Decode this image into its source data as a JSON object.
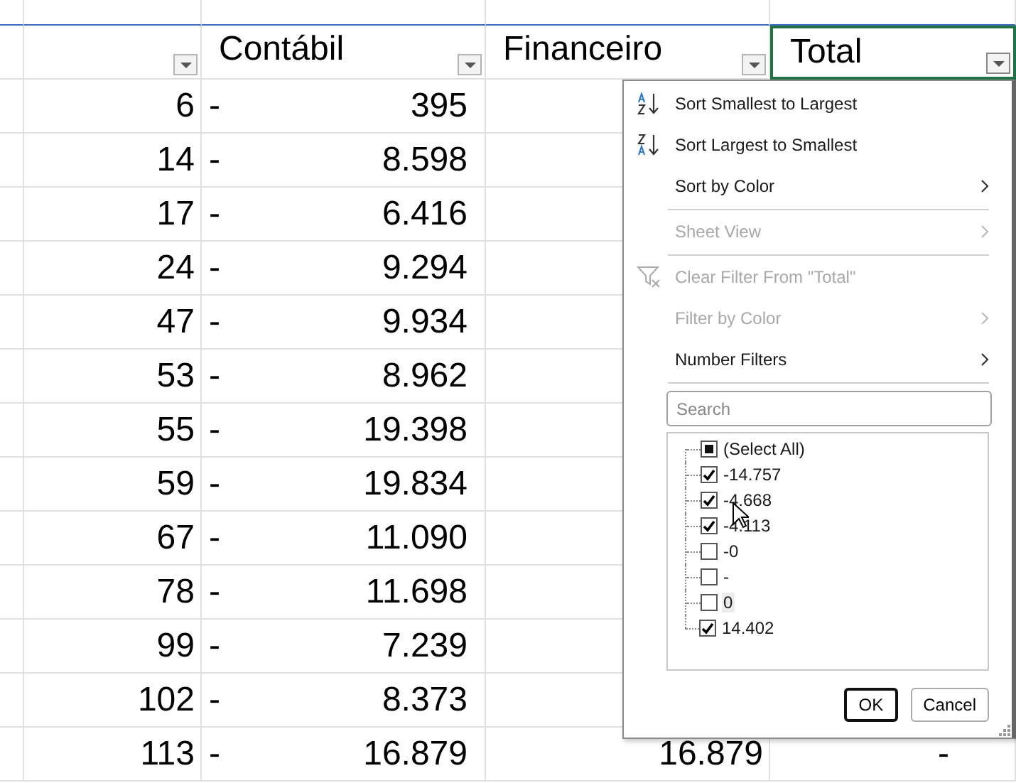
{
  "columns": [
    {
      "filter": true,
      "selected": false
    },
    {
      "label": "Contábil",
      "filter": true,
      "selected": false
    },
    {
      "label": "Financeiro",
      "filter": true,
      "selected": false
    },
    {
      "label": "Total",
      "filter": true,
      "selected": true
    }
  ],
  "rows": [
    {
      "id": "6",
      "contabil": {
        "sign": "-",
        "value": "395"
      }
    },
    {
      "id": "14",
      "contabil": {
        "sign": "-",
        "value": "8.598"
      }
    },
    {
      "id": "17",
      "contabil": {
        "sign": "-",
        "value": "6.416"
      }
    },
    {
      "id": "24",
      "contabil": {
        "sign": "-",
        "value": "9.294"
      }
    },
    {
      "id": "47",
      "contabil": {
        "sign": "-",
        "value": "9.934"
      }
    },
    {
      "id": "53",
      "contabil": {
        "sign": "-",
        "value": "8.962"
      }
    },
    {
      "id": "55",
      "contabil": {
        "sign": "-",
        "value": "19.398"
      }
    },
    {
      "id": "59",
      "contabil": {
        "sign": "-",
        "value": "19.834"
      }
    },
    {
      "id": "67",
      "contabil": {
        "sign": "-",
        "value": "11.090"
      }
    },
    {
      "id": "78",
      "contabil": {
        "sign": "-",
        "value": "11.698"
      }
    },
    {
      "id": "99",
      "contabil": {
        "sign": "-",
        "value": "7.239"
      }
    },
    {
      "id": "102",
      "contabil": {
        "sign": "-",
        "value": "8.373"
      }
    },
    {
      "id": "113",
      "contabil": {
        "sign": "-",
        "value": "16.879"
      },
      "financeiro": "16.879",
      "total": "-"
    }
  ],
  "filter_menu": {
    "items": [
      {
        "label": "Sort Smallest to Largest",
        "kind": "sort_ascending",
        "disabled": false,
        "submenu": false,
        "divider_after": false
      },
      {
        "label": "Sort Largest to Smallest",
        "kind": "sort_descending",
        "disabled": false,
        "submenu": false,
        "divider_after": false
      },
      {
        "label": "Sort by Color",
        "kind": "plain",
        "disabled": false,
        "submenu": true,
        "divider_after": true
      },
      {
        "label": "Sheet View",
        "kind": "plain",
        "disabled": true,
        "submenu": true,
        "divider_after": true
      },
      {
        "label": "Clear Filter From \"Total\"",
        "kind": "clear_filter",
        "disabled": true,
        "submenu": false,
        "divider_after": false
      },
      {
        "label": "Filter by Color",
        "kind": "plain",
        "disabled": true,
        "submenu": true,
        "divider_after": false
      },
      {
        "label": "Number Filters",
        "kind": "plain",
        "disabled": false,
        "submenu": true,
        "divider_after": true
      }
    ],
    "search": {
      "placeholder": "Search"
    },
    "values": [
      {
        "label": "(Select All)",
        "checked": false,
        "partial": true,
        "focused": false
      },
      {
        "label": "-14.757",
        "checked": true,
        "focused": false
      },
      {
        "label": "-4.668",
        "checked": true,
        "focused": false
      },
      {
        "label": "-4.113",
        "checked": true,
        "focused": false
      },
      {
        "label": "-0",
        "checked": false,
        "focused": false
      },
      {
        "label": "-",
        "checked": false,
        "focused": false
      },
      {
        "label": "0",
        "checked": false,
        "focused": true
      },
      {
        "label": "14.402",
        "checked": true,
        "focused": false
      }
    ],
    "buttons": [
      {
        "label": "OK",
        "default": true
      },
      {
        "label": "Cancel",
        "default": false
      }
    ]
  }
}
